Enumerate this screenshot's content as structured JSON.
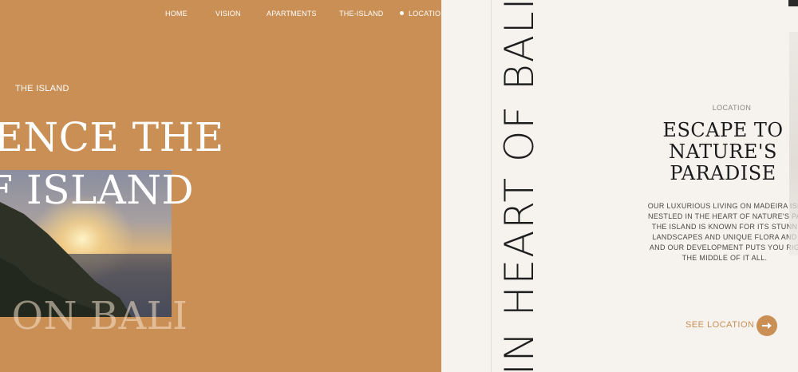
{
  "nav": {
    "items": [
      {
        "label": "HOME"
      },
      {
        "label": "VISION"
      },
      {
        "label": "APARTMENTS"
      },
      {
        "label": "THE-ISLAND"
      },
      {
        "label": "LOCATION",
        "active": true
      }
    ]
  },
  "hero": {
    "eyebrow": "THE ISLAND",
    "line1": "RIENCE THE",
    "line2": "Y OF ISLAND",
    "line3": "G ON BALI",
    "photo_icon": "sunset-photo"
  },
  "location": {
    "vertical_text": "IN HEART OF BALI",
    "eyebrow": "LOCATION",
    "title_lines": [
      "ESCAPE TO",
      "NATURE'S",
      "PARADISE"
    ],
    "paragraph_lines": [
      "OUR LUXURIOUS LIVING ON MADEIRA ISL",
      "NESTLED IN THE HEART OF NATURE'S PA",
      "THE ISLAND IS KNOWN FOR ITS STUNN",
      "LANDSCAPES AND UNIQUE FLORA AND",
      "AND OUR DEVELOPMENT PUTS YOU RIG",
      "THE MIDDLE OF IT ALL."
    ],
    "cta_label": "SEE LOCATION",
    "cta_icon": "arrow-right-icon"
  },
  "colors": {
    "accent": "#c98f55",
    "panel_light": "#f6f3ef",
    "text_dark": "#1b1b1b"
  }
}
